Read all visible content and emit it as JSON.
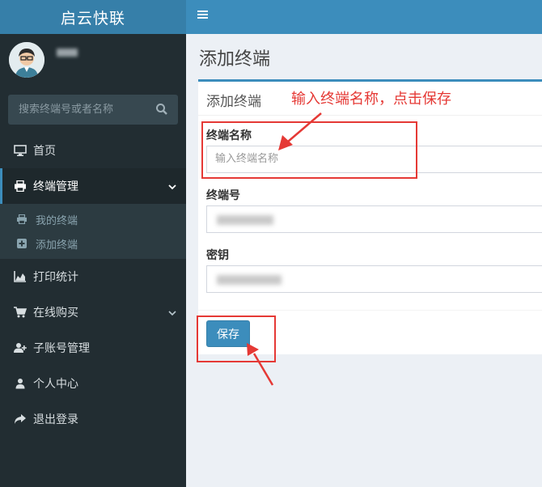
{
  "app": {
    "logo": "启云快联"
  },
  "user": {
    "name": ""
  },
  "search": {
    "placeholder": "搜索终端号或者名称",
    "icon": "search-icon"
  },
  "sidebar": {
    "items": [
      {
        "label": "首页",
        "icon": "desktop-icon"
      },
      {
        "label": "终端管理",
        "icon": "printer-icon",
        "active": true,
        "expanded": true,
        "children": [
          {
            "label": "我的终端",
            "icon": "printer-icon"
          },
          {
            "label": "添加终端",
            "icon": "plus-square-icon"
          }
        ]
      },
      {
        "label": "打印统计",
        "icon": "area-chart-icon"
      },
      {
        "label": "在线购买",
        "icon": "cart-icon",
        "has_children": true
      },
      {
        "label": "子账号管理",
        "icon": "user-plus-icon"
      },
      {
        "label": "个人中心",
        "icon": "user-icon"
      },
      {
        "label": "退出登录",
        "icon": "share-icon"
      }
    ]
  },
  "topbar": {
    "menu_icon": "hamburger-icon"
  },
  "page": {
    "title": "添加终端"
  },
  "form": {
    "box_title": "添加终端",
    "annotation": "输入终端名称，点击保存",
    "fields": [
      {
        "label": "终端名称",
        "value": "",
        "placeholder": "输入终端名称"
      },
      {
        "label": "终端号",
        "value": ""
      },
      {
        "label": "密钥",
        "value": ""
      }
    ],
    "save_label": "保存"
  },
  "colors": {
    "accent": "#3c8dbc",
    "sidebar": "#222d32",
    "annotation": "#e53935"
  }
}
